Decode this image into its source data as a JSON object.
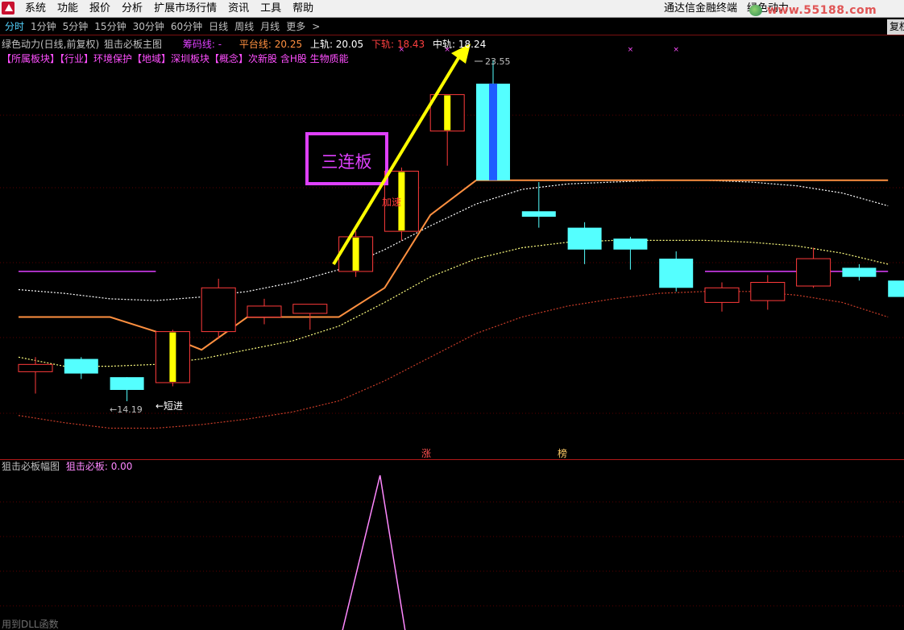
{
  "menu": {
    "items": [
      "系统",
      "功能",
      "报价",
      "分析",
      "扩展市场行情",
      "资讯",
      "工具",
      "帮助"
    ],
    "right_items": [
      "通达信金融终端",
      "绿色动力"
    ],
    "watermark": "www.55188.com"
  },
  "periods": {
    "items": [
      "分时",
      "1分钟",
      "5分钟",
      "15分钟",
      "30分钟",
      "60分钟",
      "日线",
      "周线",
      "月线",
      "更多",
      ">"
    ],
    "active_index": 0,
    "fuquan_label": "复权"
  },
  "main_legend": {
    "stock_title": "绿色动力(日线,前复权)",
    "indicator_name": "狙击必板主图",
    "chip_line": "筹码线: -",
    "platform_line": "平台线: 20.25",
    "upper_rail": "上轨: 20.05",
    "lower_rail": "下轨: 18.43",
    "middle_rail": "中轨: 18.24"
  },
  "sector_line": "【所属板块】【行业】环境保护【地域】深圳板块【概念】次新股 含H股 生物质能",
  "annotations": {
    "box_label": "三连板",
    "accelerate": "加速",
    "short_entry": "←短进",
    "low_price": "←14.19",
    "high_price": "23.55",
    "zhang": "涨",
    "bang": "榜"
  },
  "sub_legend": {
    "indicator_name": "狙击必板幅图",
    "value_label": "狙击必板: 0.00"
  },
  "formula_note": "用到DLL函数",
  "colors": {
    "up": "#ff3b3b",
    "down": "#54ffff",
    "limit_up_stripe": "#ffff00",
    "limit_up_special": "#1e5cff",
    "platform_line": "#ff9040",
    "upper_band": "#ffffff",
    "middle_band": "#ffff80",
    "lower_band": "#c83c28",
    "purple_line": "#e040ff",
    "arrow": "#ffff00",
    "sub_line": "#ff88ff",
    "grid": "#5a0000"
  },
  "chart_data": [
    {
      "type": "candlestick",
      "title": "",
      "ylim": [
        12.6,
        24.2
      ],
      "candles": [
        {
          "o": 15.0,
          "c": 15.2,
          "h": 15.4,
          "l": 14.4,
          "dir": "up"
        },
        {
          "o": 15.35,
          "c": 14.95,
          "h": 15.4,
          "l": 14.8,
          "dir": "down"
        },
        {
          "o": 14.85,
          "c": 14.5,
          "h": 14.85,
          "l": 14.19,
          "dir": "down"
        },
        {
          "o": 14.7,
          "c": 16.1,
          "h": 16.15,
          "l": 14.6,
          "dir": "up",
          "limit_up": true
        },
        {
          "o": 16.1,
          "c": 17.3,
          "h": 17.55,
          "l": 15.9,
          "dir": "up"
        },
        {
          "o": 16.5,
          "c": 16.8,
          "h": 17.0,
          "l": 16.3,
          "dir": "up"
        },
        {
          "o": 16.6,
          "c": 16.85,
          "h": 16.85,
          "l": 16.15,
          "dir": "up"
        },
        {
          "o": 17.75,
          "c": 18.7,
          "h": 18.85,
          "l": 17.6,
          "dir": "up",
          "limit_up": true
        },
        {
          "o": 18.85,
          "c": 20.5,
          "h": 20.6,
          "l": 18.6,
          "dir": "up",
          "limit_up": true
        },
        {
          "o": 21.6,
          "c": 22.6,
          "h": 22.6,
          "l": 20.65,
          "dir": "up",
          "limit_up": true
        },
        {
          "o": 20.25,
          "c": 22.9,
          "h": 23.55,
          "l": 20.25,
          "dir": "down",
          "special": true
        },
        {
          "o": 19.4,
          "c": 19.25,
          "h": 20.2,
          "l": 18.95,
          "dir": "down"
        },
        {
          "o": 18.95,
          "c": 18.35,
          "h": 19.1,
          "l": 17.95,
          "dir": "down"
        },
        {
          "o": 18.65,
          "c": 18.35,
          "h": 18.7,
          "l": 17.8,
          "dir": "down"
        },
        {
          "o": 18.1,
          "c": 17.3,
          "h": 18.3,
          "l": 17.2,
          "dir": "down"
        },
        {
          "o": 16.9,
          "c": 17.3,
          "h": 17.45,
          "l": 16.65,
          "dir": "up"
        },
        {
          "o": 16.95,
          "c": 17.45,
          "h": 17.65,
          "l": 16.7,
          "dir": "up"
        },
        {
          "o": 17.35,
          "c": 18.1,
          "h": 18.4,
          "l": 17.3,
          "dir": "up"
        },
        {
          "o": 17.85,
          "c": 17.6,
          "h": 17.95,
          "l": 17.5,
          "dir": "down"
        },
        {
          "o": 17.5,
          "c": 17.05,
          "h": 17.75,
          "l": 16.85,
          "dir": "down"
        }
      ],
      "platform_line": [
        16.5,
        16.5,
        16.5,
        16.1,
        15.6,
        16.5,
        16.5,
        16.5,
        17.3,
        19.3,
        20.25,
        20.25,
        20.25,
        20.25,
        20.25,
        20.25,
        20.25,
        20.25,
        20.25,
        20.25
      ],
      "upper_band": [
        17.25,
        17.15,
        17.0,
        16.95,
        17.05,
        17.2,
        17.45,
        17.8,
        18.35,
        19.0,
        19.6,
        20.0,
        20.15,
        20.2,
        20.25,
        20.25,
        20.2,
        20.1,
        19.9,
        19.55
      ],
      "middle_band": [
        15.4,
        15.15,
        15.15,
        15.2,
        15.35,
        15.6,
        15.85,
        16.25,
        16.9,
        17.6,
        18.1,
        18.4,
        18.55,
        18.6,
        18.6,
        18.6,
        18.55,
        18.45,
        18.25,
        17.95
      ],
      "lower_band": [
        13.8,
        13.6,
        13.45,
        13.45,
        13.55,
        13.7,
        13.9,
        14.2,
        14.75,
        15.4,
        16.05,
        16.5,
        16.8,
        17.0,
        17.15,
        17.2,
        17.2,
        17.1,
        16.9,
        16.5
      ],
      "purple_segments": [
        {
          "from": 0,
          "to": 3,
          "value": 17.75
        },
        {
          "from": 15,
          "to": 19,
          "value": 17.75
        }
      ],
      "cross_markers": [
        8,
        9,
        13,
        14
      ]
    },
    {
      "type": "line",
      "title": "",
      "ylim": [
        0,
        1
      ],
      "x": [
        7,
        7.9,
        8.5
      ],
      "values": [
        0,
        1,
        0
      ]
    }
  ]
}
